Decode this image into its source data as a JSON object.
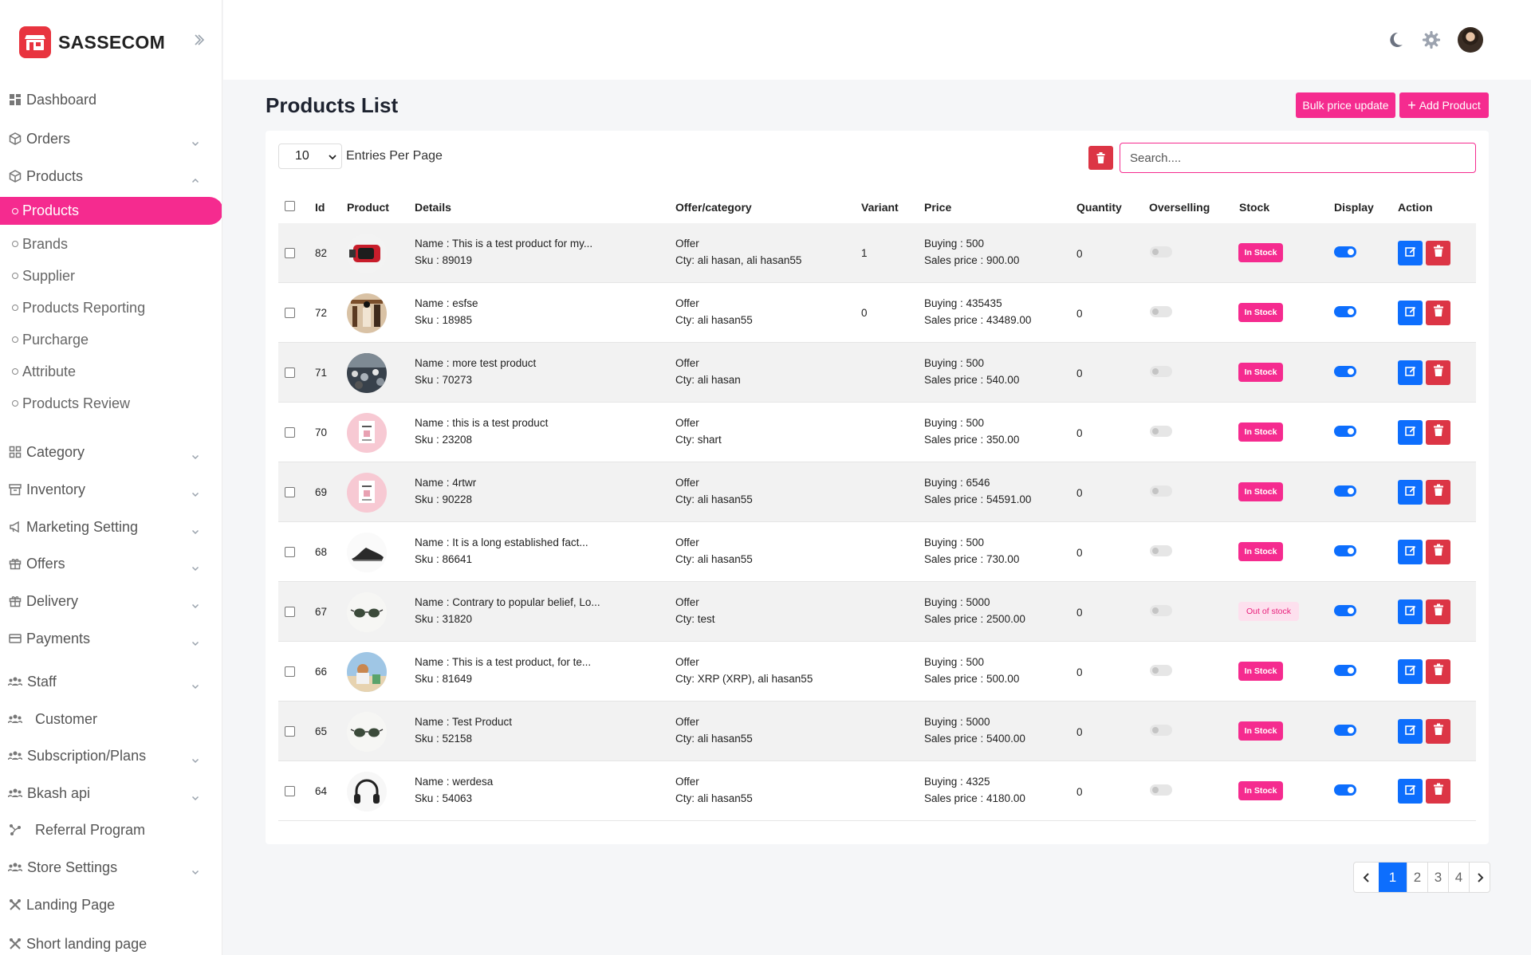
{
  "brand": {
    "name": "SASSECOM"
  },
  "sidebar": {
    "items": [
      {
        "label": "Dashboard",
        "icon": "dashboard-icon",
        "chevron": ""
      },
      {
        "label": "Orders",
        "icon": "box-icon",
        "chevron": "down"
      },
      {
        "label": "Products",
        "icon": "box-icon",
        "chevron": "up"
      },
      {
        "label": "Category",
        "icon": "grid-icon",
        "chevron": "down"
      },
      {
        "label": "Inventory",
        "icon": "archive-icon",
        "chevron": "down"
      },
      {
        "label": "Marketing Setting",
        "icon": "megaphone-icon",
        "chevron": "down"
      },
      {
        "label": "Offers",
        "icon": "gift-icon",
        "chevron": "down"
      },
      {
        "label": "Delivery",
        "icon": "gift-icon",
        "chevron": "down"
      },
      {
        "label": "Payments",
        "icon": "card-icon",
        "chevron": "down"
      },
      {
        "label": "Staff",
        "icon": "users-icon",
        "chevron": "down"
      },
      {
        "label": "Customer",
        "icon": "users-icon",
        "chevron": ""
      },
      {
        "label": "Subscription/Plans",
        "icon": "users-icon",
        "chevron": "down"
      },
      {
        "label": "Bkash api",
        "icon": "users-icon",
        "chevron": "down"
      },
      {
        "label": "Referral Program",
        "icon": "share-icon",
        "chevron": ""
      },
      {
        "label": "Store Settings",
        "icon": "users-icon",
        "chevron": "down"
      },
      {
        "label": "Landing Page",
        "icon": "tools-icon",
        "chevron": ""
      },
      {
        "label": "Short landing page",
        "icon": "tools-icon",
        "chevron": ""
      }
    ],
    "product_sub": [
      {
        "label": "Products",
        "active": true
      },
      {
        "label": "Brands"
      },
      {
        "label": "Supplier"
      },
      {
        "label": "Products Reporting"
      },
      {
        "label": "Purcharge"
      },
      {
        "label": "Attribute"
      },
      {
        "label": "Products Review"
      }
    ]
  },
  "page": {
    "title": "Products List",
    "bulk_label": "Bulk price update",
    "add_label": "Add Product",
    "entries_value": "10",
    "entries_label": "Entries Per Page",
    "search_placeholder": "Search...."
  },
  "table": {
    "columns": [
      "Id",
      "Product",
      "Details",
      "Offer/category",
      "Variant",
      "Price",
      "Quantity",
      "Overselling",
      "Stock",
      "Display",
      "Action"
    ],
    "rows": [
      {
        "id": "82",
        "name": "Name : This is a test product for my...",
        "sku": "Sku : 89019",
        "offer": "Offer",
        "cty": "Cty: ali hasan, ali hasan55",
        "variant": "1",
        "buying": "Buying : 500",
        "sales": "Sales price : 900.00",
        "qty": "0",
        "stock": "In Stock",
        "in_stock": true,
        "thumb": "watch"
      },
      {
        "id": "72",
        "name": "Name : esfse",
        "sku": "Sku : 18985",
        "offer": "Offer",
        "cty": "Cty: ali hasan55",
        "variant": "0",
        "buying": "Buying : 435435",
        "sales": "Sales price : 43489.00",
        "qty": "0",
        "stock": "In Stock",
        "in_stock": true,
        "thumb": "shop"
      },
      {
        "id": "71",
        "name": "Name : more test product",
        "sku": "Sku : 70273",
        "offer": "Offer",
        "cty": "Cty: ali hasan",
        "variant": "",
        "buying": "Buying : 500",
        "sales": "Sales price : 540.00",
        "qty": "0",
        "stock": "In Stock",
        "in_stock": true,
        "thumb": "crowd"
      },
      {
        "id": "70",
        "name": "Name : this is a test product",
        "sku": "Sku : 23208",
        "offer": "Offer",
        "cty": "Cty: shart",
        "variant": "",
        "buying": "Buying : 500",
        "sales": "Sales price : 350.00",
        "qty": "0",
        "stock": "In Stock",
        "in_stock": true,
        "thumb": "pink"
      },
      {
        "id": "69",
        "name": "Name : 4rtwr",
        "sku": "Sku : 90228",
        "offer": "Offer",
        "cty": "Cty: ali hasan55",
        "variant": "",
        "buying": "Buying : 6546",
        "sales": "Sales price : 54591.00",
        "qty": "0",
        "stock": "In Stock",
        "in_stock": true,
        "thumb": "pink"
      },
      {
        "id": "68",
        "name": "Name : It is a long established fact...",
        "sku": "Sku : 86641",
        "offer": "Offer",
        "cty": "Cty: ali hasan55",
        "variant": "",
        "buying": "Buying : 500",
        "sales": "Sales price : 730.00",
        "qty": "0",
        "stock": "In Stock",
        "in_stock": true,
        "thumb": "shoe"
      },
      {
        "id": "67",
        "name": "Name : Contrary to popular belief, Lo...",
        "sku": "Sku : 31820",
        "offer": "Offer",
        "cty": "Cty: test",
        "variant": "",
        "buying": "Buying : 5000",
        "sales": "Sales price : 2500.00",
        "qty": "0",
        "stock": "Out of stock",
        "in_stock": false,
        "thumb": "glasses"
      },
      {
        "id": "66",
        "name": "Name : This is a test product, for te...",
        "sku": "Sku : 81649",
        "offer": "Offer",
        "cty": "Cty: XRP (XRP), ali hasan55",
        "variant": "",
        "buying": "Buying : 500",
        "sales": "Sales price : 500.00",
        "qty": "0",
        "stock": "In Stock",
        "in_stock": true,
        "thumb": "beach"
      },
      {
        "id": "65",
        "name": "Name : Test Product",
        "sku": "Sku : 52158",
        "offer": "Offer",
        "cty": "Cty: ali hasan55",
        "variant": "",
        "buying": "Buying : 5000",
        "sales": "Sales price : 5400.00",
        "qty": "0",
        "stock": "In Stock",
        "in_stock": true,
        "thumb": "glasses"
      },
      {
        "id": "64",
        "name": "Name : werdesa",
        "sku": "Sku : 54063",
        "offer": "Offer",
        "cty": "Cty: ali hasan55",
        "variant": "",
        "buying": "Buying : 4325",
        "sales": "Sales price : 4180.00",
        "qty": "0",
        "stock": "In Stock",
        "in_stock": true,
        "thumb": "headphones"
      }
    ]
  },
  "pagination": {
    "pages": [
      "1",
      "2",
      "3",
      "4"
    ],
    "active": "1"
  },
  "colors": {
    "accent": "#f52b8f",
    "brand": "#e8343f",
    "primary": "#0d6efd",
    "danger": "#dc3545"
  }
}
